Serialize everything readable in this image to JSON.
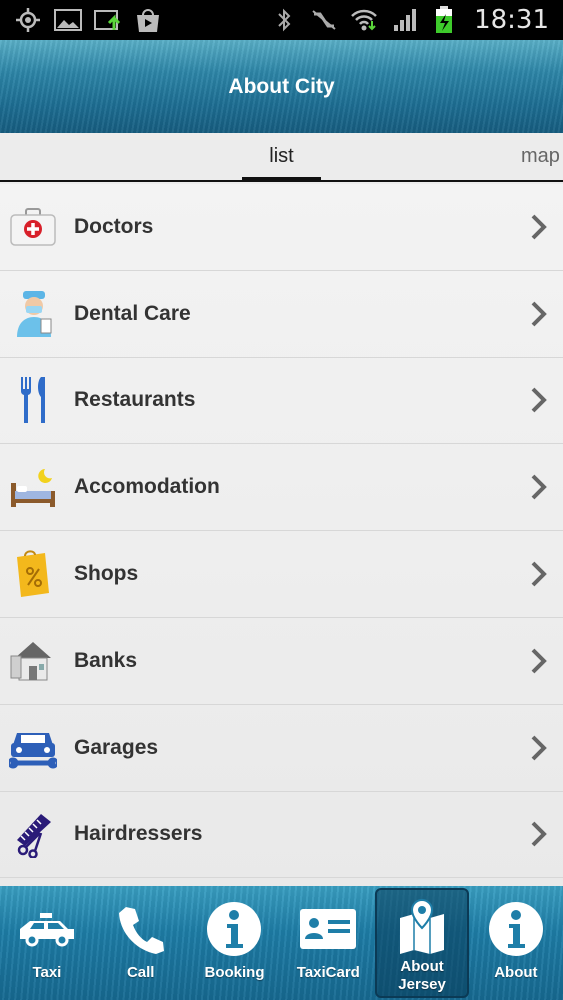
{
  "status_bar": {
    "time": "18:31",
    "left_icons": [
      "gps-icon",
      "image-icon",
      "upload-icon",
      "play-store-icon"
    ],
    "right_icons": [
      "bluetooth-icon",
      "mute-icon",
      "wifi-icon",
      "signal-icon",
      "battery-charging-icon"
    ]
  },
  "header": {
    "title": "About City"
  },
  "tabs": [
    {
      "label": "list",
      "active": true
    },
    {
      "label": "map",
      "active": false
    }
  ],
  "categories": [
    {
      "label": "Doctors",
      "icon": "first-aid-kit-icon"
    },
    {
      "label": "Dental Care",
      "icon": "dentist-icon"
    },
    {
      "label": "Restaurants",
      "icon": "fork-knife-icon"
    },
    {
      "label": "Accomodation",
      "icon": "bed-icon"
    },
    {
      "label": "Shops",
      "icon": "shopping-bag-icon"
    },
    {
      "label": "Banks",
      "icon": "bank-building-icon"
    },
    {
      "label": "Garages",
      "icon": "car-wrench-icon"
    },
    {
      "label": "Hairdressers",
      "icon": "comb-scissors-icon"
    }
  ],
  "bottom_nav": [
    {
      "label": "Taxi",
      "icon": "taxi-icon"
    },
    {
      "label": "Call",
      "icon": "phone-icon"
    },
    {
      "label": "Booking",
      "icon": "info-icon"
    },
    {
      "label": "TaxiCard",
      "icon": "id-card-icon"
    },
    {
      "label": "About Jersey",
      "icon": "map-pin-icon",
      "active": true
    },
    {
      "label": "About",
      "icon": "info-icon"
    }
  ],
  "colors": {
    "header": "#2d86a8",
    "nav": "#1e7ea8",
    "text": "#333333"
  }
}
